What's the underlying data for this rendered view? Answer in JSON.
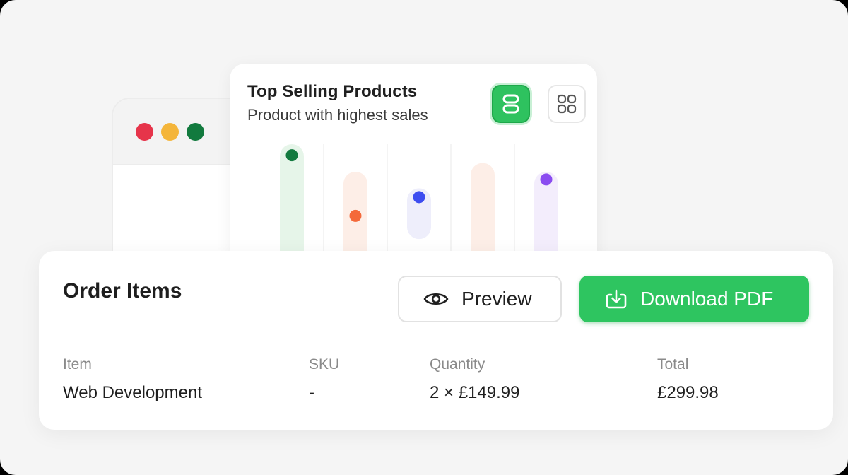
{
  "browser_window": {
    "dots": [
      {
        "name": "close",
        "color": "#e6344a"
      },
      {
        "name": "minimize",
        "color": "#f4b53a"
      },
      {
        "name": "maximize",
        "color": "#127a3e"
      }
    ]
  },
  "chart_card": {
    "title": "Top Selling Products",
    "subtitle": "Product with highest sales",
    "view_buttons": [
      {
        "name": "list-view",
        "icon": "stacked-rows-icon",
        "active": true
      },
      {
        "name": "grid-view",
        "icon": "grid-icon",
        "active": false
      }
    ]
  },
  "chart_data": {
    "type": "bar",
    "title": "Top Selling Products",
    "subtitle": "Product with highest sales",
    "categories": [],
    "series": [
      {
        "color": "#137a3f",
        "track_color": "#e6f5e9",
        "range": [
          0,
          1.0
        ],
        "value": 0.9
      },
      {
        "color": "#f4693a",
        "track_color": "#fdeee7",
        "range": [
          0,
          0.75
        ],
        "value": 0.35
      },
      {
        "color": "#3d4df0",
        "track_color": "#eeeefb",
        "range": [
          0.14,
          0.6
        ],
        "value": 0.52
      },
      {
        "color": "#f4693a",
        "track_color": "#fdeee7",
        "range": [
          0,
          0.83
        ],
        "value": null
      },
      {
        "color": "#8a4cf0",
        "track_color": "#f3edfc",
        "range": [
          0,
          0.75
        ],
        "value": 0.68
      }
    ],
    "grid": "vertical",
    "legend": "none"
  },
  "order_card": {
    "title": "Order Items",
    "preview_label": "Preview",
    "preview_icon": "eye-icon",
    "download_label": "Download PDF",
    "download_icon": "download-icon",
    "accent": "#2ec560",
    "columns": [
      "Item",
      "SKU",
      "Quantity",
      "Total"
    ],
    "rows": [
      {
        "item": "Web Development",
        "sku": "-",
        "quantity": "2 × £149.99",
        "total": "£299.98"
      }
    ]
  }
}
